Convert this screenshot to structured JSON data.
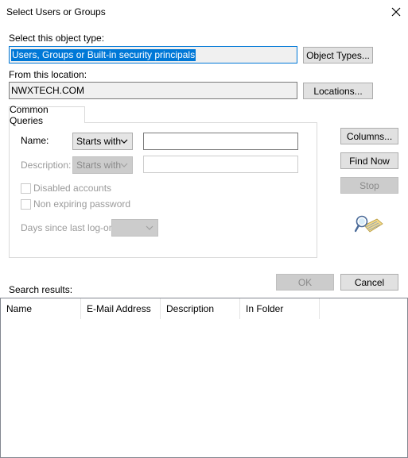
{
  "window": {
    "title": "Select Users or Groups",
    "close_glyph": "✕"
  },
  "object_type": {
    "label": "Select this object type:",
    "value": "Users, Groups or Built-in security principals",
    "button": "Object Types..."
  },
  "location": {
    "label": "From this location:",
    "value": "NWXTECH.COM",
    "button": "Locations..."
  },
  "queries": {
    "tab_label": "Common Queries",
    "name_label": "Name:",
    "name_operator": "Starts with",
    "name_value": "",
    "description_label": "Description:",
    "description_operator": "Starts with",
    "description_value": "",
    "disabled_accounts_label": "Disabled accounts",
    "non_expiring_label": "Non expiring password",
    "days_label": "Days since last log-on:",
    "days_value": ""
  },
  "side_buttons": {
    "columns": "Columns...",
    "find_now": "Find Now",
    "stop": "Stop"
  },
  "footer_buttons": {
    "ok": "OK",
    "cancel": "Cancel"
  },
  "results": {
    "label": "Search results:",
    "columns": [
      "Name",
      "E-Mail Address",
      "Description",
      "In Folder"
    ],
    "rows": []
  },
  "colors": {
    "accent": "#0078d7",
    "button_face": "#e1e1e1",
    "disabled_text": "#8a8a8a"
  },
  "icons": {
    "search_graphic": "magnifier-over-directory-icon"
  }
}
